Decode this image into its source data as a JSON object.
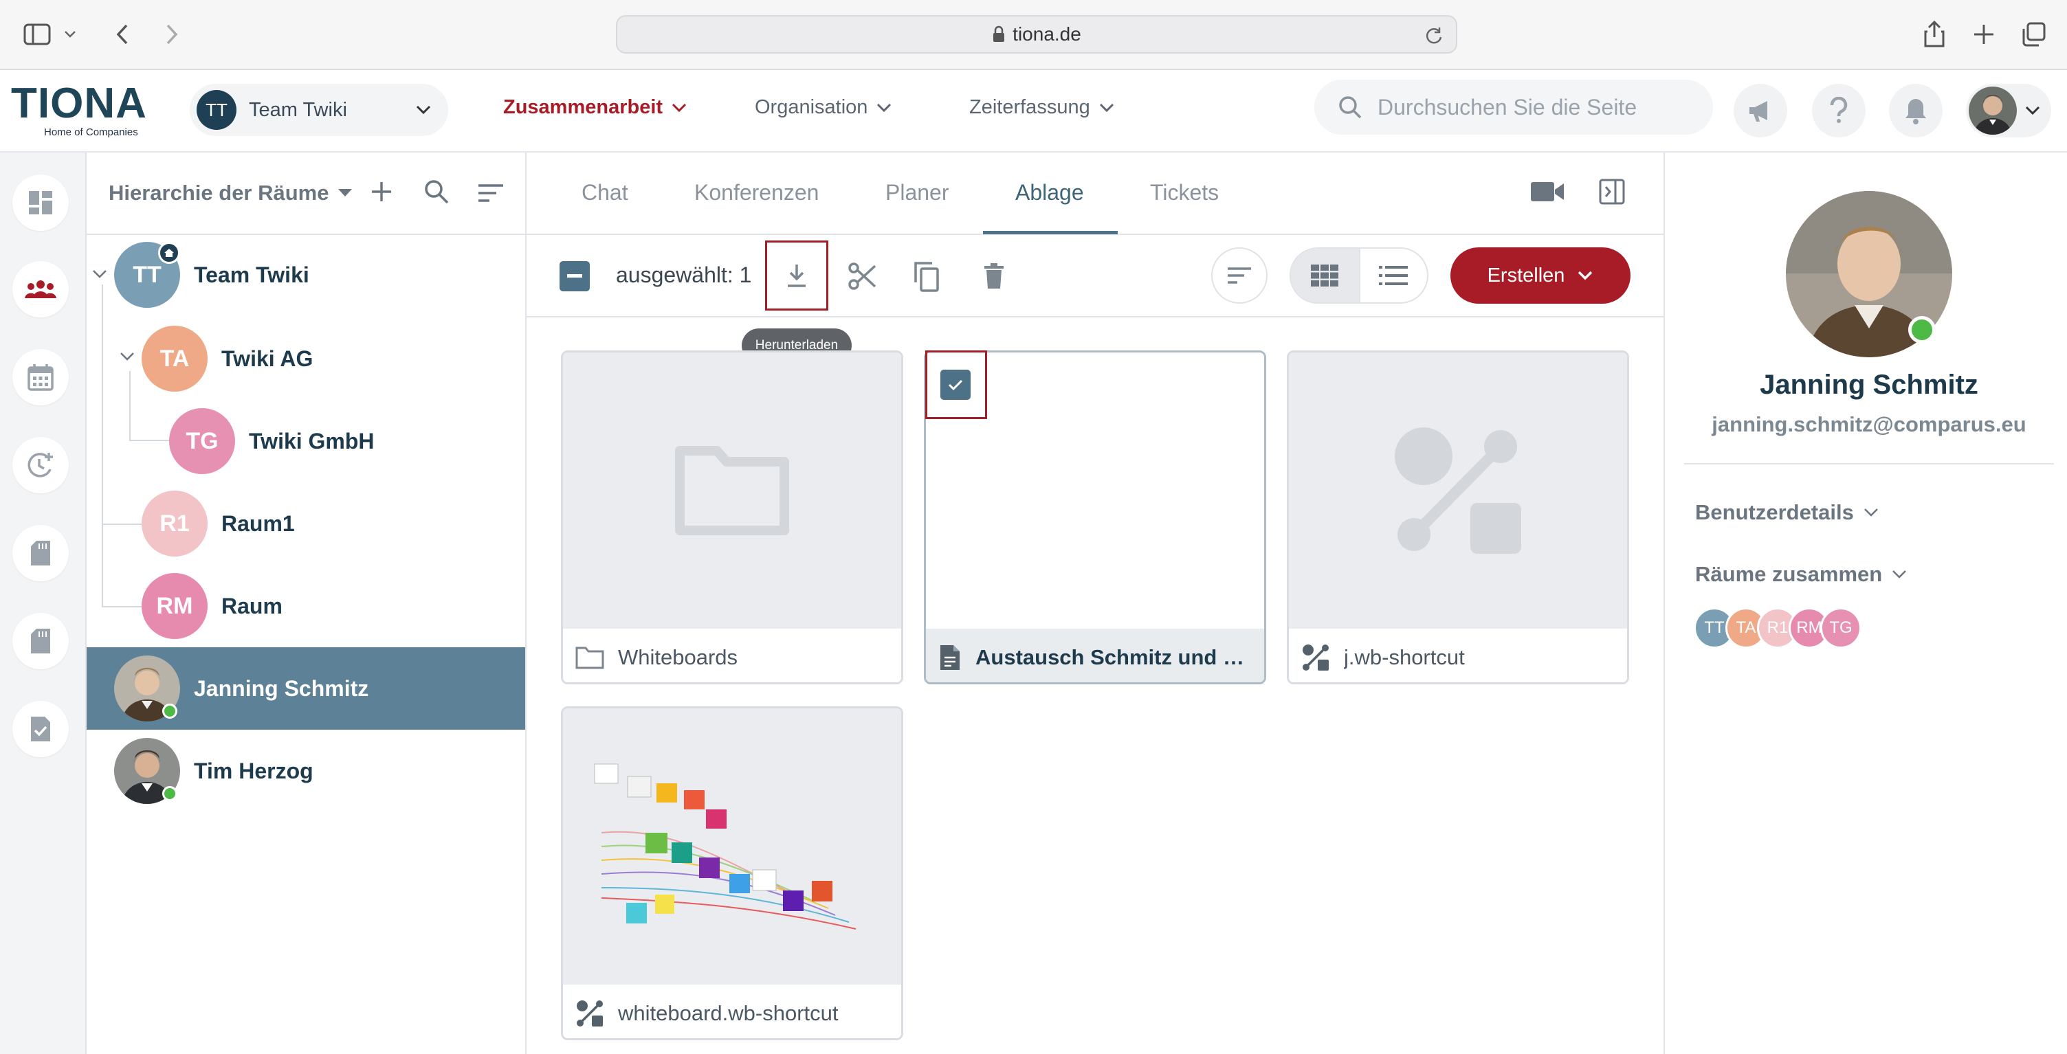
{
  "browser": {
    "url": "tiona.de"
  },
  "header": {
    "logo": "TIONA",
    "logo_sub": "Home of Companies",
    "team": {
      "initials": "TT",
      "name": "Team Twiki"
    },
    "nav": [
      "Zusammenarbeit",
      "Organisation",
      "Zeiterfassung"
    ],
    "search_placeholder": "Durchsuchen Sie die Seite"
  },
  "hierarchy": {
    "title": "Hierarchie der Räume",
    "items": [
      {
        "initials": "TT",
        "name": "Team Twiki",
        "color": "#7a9fb4"
      },
      {
        "initials": "TA",
        "name": "Twiki AG",
        "color": "#f0a987"
      },
      {
        "initials": "TG",
        "name": "Twiki GmbH",
        "color": "#e690b2"
      },
      {
        "initials": "R1",
        "name": "Raum1",
        "color": "#f2c3c7"
      },
      {
        "initials": "RM",
        "name": "Raum",
        "color": "#e68aae"
      }
    ],
    "people": [
      {
        "name": "Janning Schmitz",
        "selected": true
      },
      {
        "name": "Tim Herzog",
        "selected": false
      }
    ]
  },
  "tabs": [
    "Chat",
    "Konferenzen",
    "Planer",
    "Ablage",
    "Tickets"
  ],
  "toolbar": {
    "selected_label": "ausgewählt: 1",
    "tooltip": "Herunterladen",
    "create_label": "Erstellen"
  },
  "files": [
    {
      "name": "Whiteboards",
      "type": "folder"
    },
    {
      "name": "Austausch Schmitz und H...",
      "type": "document",
      "selected": true
    },
    {
      "name": "j.wb-shortcut",
      "type": "shortcut"
    },
    {
      "name": "whiteboard.wb-shortcut",
      "type": "shortcut"
    }
  ],
  "profile": {
    "name": "Janning Schmitz",
    "email": "janning.schmitz@comparus.eu",
    "section_details": "Benutzerdetails",
    "section_rooms": "Räume zusammen",
    "rooms": [
      {
        "initials": "TT",
        "color": "#7a9fb4"
      },
      {
        "initials": "TA",
        "color": "#f0a987"
      },
      {
        "initials": "R1",
        "color": "#f2c3c7"
      },
      {
        "initials": "RM",
        "color": "#e68aae"
      },
      {
        "initials": "TG",
        "color": "#e690b2"
      }
    ]
  },
  "colors": {
    "brand": "#1f4658",
    "accent_red": "#a81c28",
    "selection": "#4d7186",
    "online": "#4cba45"
  }
}
